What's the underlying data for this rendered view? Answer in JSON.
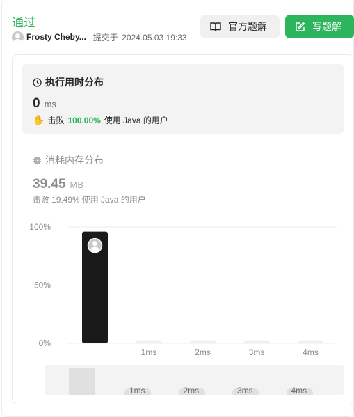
{
  "status": "通过",
  "submission": {
    "username": "Frosty Cheby...",
    "submitted_label": "提交于",
    "date": "2024.05.03 19:33"
  },
  "buttons": {
    "official_solution": "官方题解",
    "write_solution": "写题解"
  },
  "runtime": {
    "title": "执行用时分布",
    "value": "0",
    "unit": "ms",
    "beats_label": "击败",
    "beats_pct": "100.00%",
    "users_text": "使用 Java 的用户"
  },
  "memory": {
    "title": "消耗内存分布",
    "value": "39.45",
    "unit": "MB",
    "beats_label": "击败",
    "beats_pct": "19.49%",
    "users_text": "使用 Java 的用户"
  },
  "navigator": {
    "labels": [
      "1ms",
      "2ms",
      "3ms",
      "4ms"
    ]
  },
  "chart_data": {
    "type": "bar",
    "categories": [
      "",
      "1ms",
      "2ms",
      "3ms",
      "4ms"
    ],
    "values": [
      96,
      2,
      2,
      2,
      2
    ],
    "ylim": [
      0,
      100
    ],
    "yticks": [
      "0%",
      "50%",
      "100%"
    ],
    "highlight_index": 0,
    "colors": {
      "highlight": "#1a1a1a",
      "bar": "#f0f0f0",
      "grid": "#eeeeee",
      "tick": "#8c8c8c"
    }
  }
}
